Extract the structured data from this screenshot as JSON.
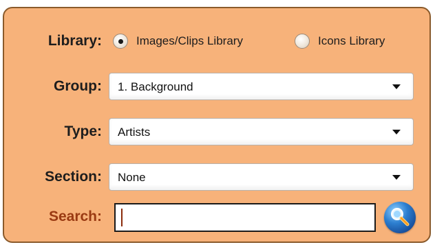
{
  "library": {
    "label": "Library:",
    "options": [
      {
        "label": "Images/Clips Library",
        "selected": true
      },
      {
        "label": "Icons Library",
        "selected": false
      }
    ]
  },
  "group": {
    "label": "Group:",
    "value": "1. Background"
  },
  "type": {
    "label": "Type:",
    "value": "Artists"
  },
  "section": {
    "label": "Section:",
    "value": "None"
  },
  "search": {
    "label": "Search:",
    "value": "",
    "button_icon": "search-magnifier-icon"
  },
  "colors": {
    "panel_bg": "#f7b27a",
    "panel_border": "#8a5a2b",
    "search_label": "#9a3a12"
  }
}
